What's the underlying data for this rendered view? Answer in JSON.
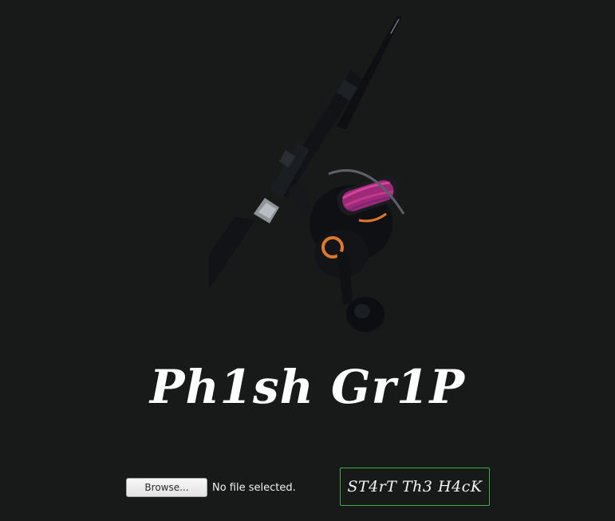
{
  "hero": {
    "image_name": "fishing-rod-and-reel-image"
  },
  "title": "Ph1sh Gr1P",
  "file_input": {
    "browse_label": "Browse...",
    "status_text": "No file selected."
  },
  "start_button": {
    "label": "ST4rT Th3 H4cK"
  },
  "colors": {
    "background": "#181919",
    "button_border": "#3fae49",
    "reel_accent": "#e0782a",
    "line_spool": "#c0398a"
  }
}
